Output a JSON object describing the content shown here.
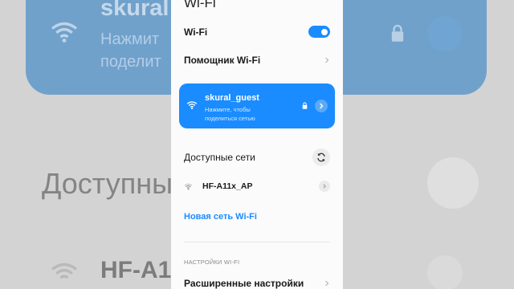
{
  "panel": {
    "title": "Wi-Fi",
    "wifi_label": "Wi-Fi",
    "wifi_enabled": true,
    "assistant_label": "Помощник Wi-Fi",
    "connected": {
      "ssid": "skural_guest",
      "subtitle_line1": "Нажмите, чтобы",
      "subtitle_line2": "поделиться сетью"
    },
    "available_label": "Доступные сети",
    "networks": [
      {
        "name": "HF-A11x_AP"
      }
    ],
    "new_network_label": "Новая сеть Wi-Fi",
    "settings_section": "НАСТРОЙКИ WI-FI",
    "advanced_label": "Расширенные настройки"
  },
  "background": {
    "ssid": "skural",
    "sub1": "Нажмит",
    "sub2": "поделит",
    "available": "Доступны",
    "network": "HF-A1"
  },
  "colors": {
    "accent": "#1a8cff",
    "background": "#d3d3d3",
    "panel": "#fbfbfb"
  }
}
